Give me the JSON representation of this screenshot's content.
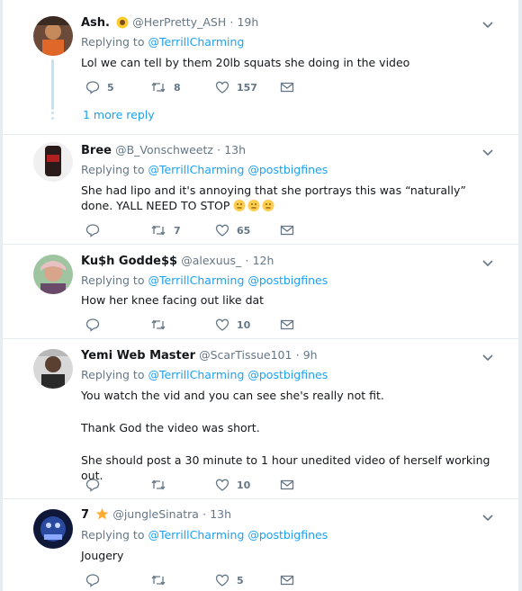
{
  "tweets": [
    {
      "name": "Ash.",
      "handle": "@HerPretty_ASH",
      "time": "19h",
      "replying_prefix": "Replying to",
      "mentions": [
        "@TerrillCharming"
      ],
      "text": "Lol we can tell by them 20lb squats she doing in the video",
      "replies": "5",
      "retweets": "8",
      "likes": "157",
      "more_reply": "1 more reply"
    },
    {
      "name": "Bree",
      "handle": "@B_Vonschweetz",
      "time": "13h",
      "replying_prefix": "Replying to",
      "mentions": [
        "@TerrillCharming",
        "@postbigfines"
      ],
      "text": "She had lipo and it's annoying that she portrays this was “naturally” done. YALL NEED TO STOP",
      "replies": "",
      "retweets": "7",
      "likes": "65"
    },
    {
      "name": "Ku$h Godde$$",
      "handle": "@alexuus_",
      "time": "12h",
      "replying_prefix": "Replying to",
      "mentions": [
        "@TerrillCharming",
        "@postbigfines"
      ],
      "text": "How her knee facing out like dat",
      "replies": "",
      "retweets": "",
      "likes": "10"
    },
    {
      "name": "Yemi Web Master",
      "handle": "@ScarTissue101",
      "time": "9h",
      "replying_prefix": "Replying to",
      "mentions": [
        "@TerrillCharming",
        "@postbigfines"
      ],
      "text_lines": [
        "You watch the vid and you can see she's really not fit.",
        "Thank God the video was short.",
        "She should post a 30 minute to 1 hour unedited video of herself working out."
      ],
      "replies": "",
      "retweets": "",
      "likes": "10"
    },
    {
      "name": "7",
      "handle": "@jungleSinatra",
      "time": "13h",
      "replying_prefix": "Replying to",
      "mentions": [
        "@TerrillCharming",
        "@postbigfines"
      ],
      "text": "Jougery",
      "replies": "",
      "retweets": "",
      "likes": "5"
    }
  ],
  "separator": "·",
  "icons": {
    "reply": "reply-icon",
    "retweet": "retweet-icon",
    "like": "heart-icon",
    "dm": "envelope-icon",
    "caret": "chevron-down-icon"
  },
  "colors": {
    "link": "#1da1f2",
    "muted": "#657786",
    "thread": "#c4e2f3"
  }
}
